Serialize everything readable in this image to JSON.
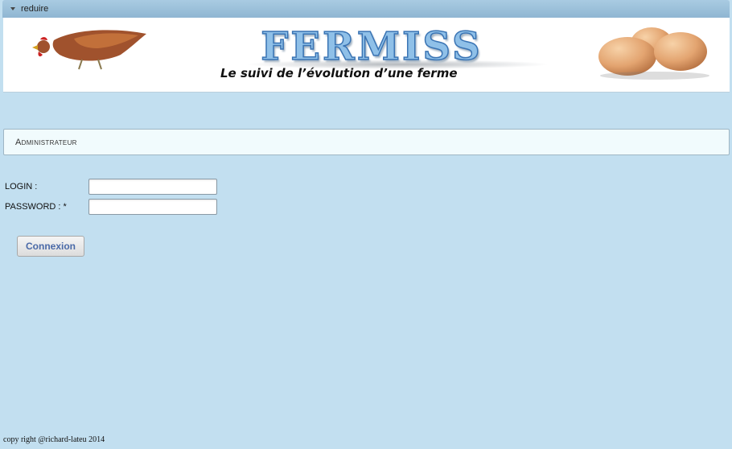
{
  "header": {
    "collapse_label": "reduire"
  },
  "banner": {
    "logo_text": "FERMISS",
    "tagline": "Le suivi de l’évolution d’une ferme"
  },
  "panel": {
    "title": "Administrateur"
  },
  "form": {
    "login_label": "LOGIN :",
    "login_value": "",
    "password_label": "PASSWORD : *",
    "password_value": "",
    "submit_label": "Connexion"
  },
  "footer": {
    "copyright": "copy right @richard-lateu 2014"
  },
  "colors": {
    "page_background": "#c2dff0",
    "panel_background": "#f1fbfd",
    "button_text": "#4a6aa8",
    "logo_fill": "#8fc0e8"
  },
  "icons": {
    "collapse": "caret-down-icon",
    "banner_left": "hen-image",
    "banner_right": "eggs-image"
  }
}
